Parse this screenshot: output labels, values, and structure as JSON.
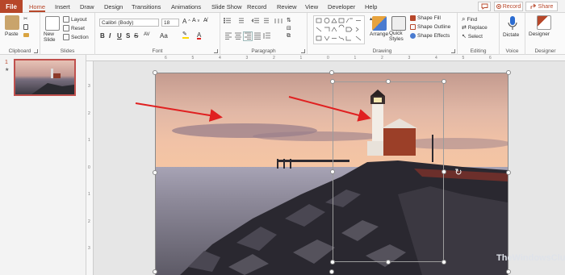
{
  "tabs": {
    "file": "File",
    "items": [
      "Home",
      "Insert",
      "Draw",
      "Design",
      "Transitions",
      "Animations",
      "Slide Show",
      "Record",
      "Review",
      "View",
      "Developer",
      "Help"
    ],
    "active": "Home"
  },
  "top_right": {
    "record_label": "Record",
    "share_label": "Share"
  },
  "ribbon": {
    "clipboard": {
      "paste": "Paste",
      "label": "Clipboard"
    },
    "slides": {
      "new_slide": "New Slide",
      "layout": "Layout",
      "reset": "Reset",
      "section": "Section",
      "label": "Slides"
    },
    "font": {
      "face": "Calibri (Body)",
      "size": "18",
      "bold": "B",
      "italic": "I",
      "underline": "U",
      "strike": "S",
      "shadow": "S",
      "charspace": "AV",
      "label": "Font"
    },
    "paragraph": {
      "label": "Paragraph"
    },
    "drawing": {
      "arrange": "Arrange",
      "quick_styles": "Quick Styles",
      "shape_fill": "Shape Fill",
      "shape_outline": "Shape Outline",
      "shape_effects": "Shape Effects",
      "label": "Drawing"
    },
    "editing": {
      "find": "Find",
      "replace": "Replace",
      "select": "Select",
      "label": "Editing"
    },
    "voice": {
      "dictate": "Dictate",
      "label": "Voice"
    },
    "designer": {
      "designer": "Designer",
      "label": "Designer"
    }
  },
  "slide_pane": {
    "slide_number": "1",
    "star": "★"
  },
  "ruler": {
    "h_labels": [
      "6",
      "5",
      "4",
      "3",
      "2",
      "1",
      "0",
      "1",
      "2",
      "3",
      "4",
      "5",
      "6"
    ],
    "v_labels": [
      "3",
      "2",
      "1",
      "0",
      "1",
      "2",
      "3"
    ]
  },
  "watermark": {
    "text": "TheWindowsClub"
  },
  "colors": {
    "accent": "#b7472a",
    "arrow": "#e02020"
  }
}
